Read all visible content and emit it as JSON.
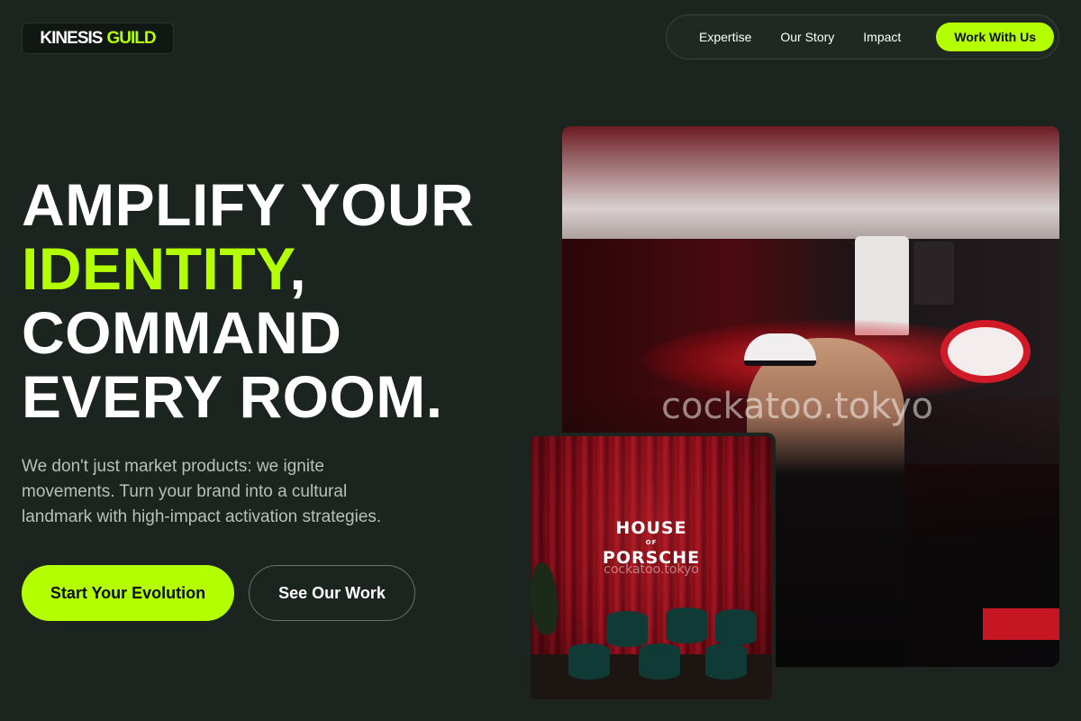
{
  "brand": {
    "name_part1": "KINESIS",
    "name_part2": "GUILD"
  },
  "nav": {
    "links": [
      "Expertise",
      "Our Story",
      "Impact"
    ],
    "cta": "Work With Us"
  },
  "hero": {
    "headline_line1": "AMPLIFY YOUR",
    "headline_highlight": "IDENTITY",
    "headline_comma": ",",
    "headline_line3": "COMMAND",
    "headline_line4": "EVERY ROOM.",
    "subtext": "We don't just market products: we ignite movements. Turn your brand into a cultural landmark with high-impact activation strategies.",
    "primary_button": "Start Your Evolution",
    "secondary_button": "See Our Work"
  },
  "images": {
    "main_watermark": "cockatoo.tokyo",
    "secondary_sign_line1": "HOUSE",
    "secondary_sign_line2": "OF",
    "secondary_sign_line3": "PORSCHE",
    "secondary_watermark": "cockatoo.tokyo"
  },
  "colors": {
    "background": "#1b241e",
    "accent": "#b4ff00",
    "text": "#ffffff"
  }
}
